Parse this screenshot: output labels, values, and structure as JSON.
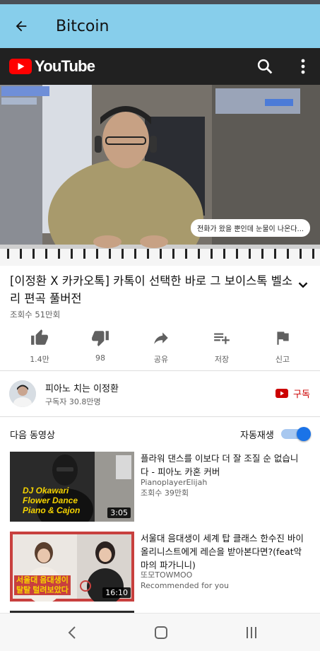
{
  "app_bar": {
    "title": "Bitcoin"
  },
  "youtube": {
    "logo_text": "YouTube"
  },
  "video": {
    "overlay_bubble": "전화가 왔을 뿐인데 눈물이 나온다...",
    "title": "[이정환 X 카카오톡] 카톡이 선택한 바로 그 보이스톡 벨소리 편곡 풀버전",
    "views": "조회수 51만회"
  },
  "actions": [
    {
      "icon": "thumb-up-icon",
      "label": "1.4만"
    },
    {
      "icon": "thumb-down-icon",
      "label": "98"
    },
    {
      "icon": "share-icon",
      "label": "공유"
    },
    {
      "icon": "playlist-add-icon",
      "label": "저장"
    },
    {
      "icon": "flag-icon",
      "label": "신고"
    }
  ],
  "channel": {
    "name": "피아노 치는 이정환",
    "subscribers": "구독자 30.8만명",
    "subscribe_label": "구독"
  },
  "up_next": {
    "label": "다음 동영상",
    "autoplay_label": "자동재생",
    "autoplay_on": true
  },
  "recommendations": [
    {
      "title": "플라워 댄스를 이보다 더 잘 조질 순 없습니다 - 피아노 카혼 커버",
      "channel": "PianoplayerElijah",
      "meta": "조회수 39만회",
      "duration": "3:05",
      "thumb_text": [
        "DJ Okawari",
        "Flower Dance",
        "Piano & Cajon"
      ]
    },
    {
      "title": "서울대 음대생이 세계 탑 클래스 한수진 바이올리니스트에게 레슨을 받아본다면?(feat악마의 파가니니)",
      "channel": "또모TOWMOO",
      "meta": "Recommended for you",
      "duration": "16:10",
      "thumb_text": [
        "서울대 음대생이",
        "탈탈 털려보았다"
      ]
    }
  ],
  "colors": {
    "app_bar": "#87ceeb",
    "youtube_bar": "#212121",
    "youtube_red": "#ff0000",
    "subscribe_red": "#cc0000",
    "toggle_blue": "#1a73e8"
  }
}
